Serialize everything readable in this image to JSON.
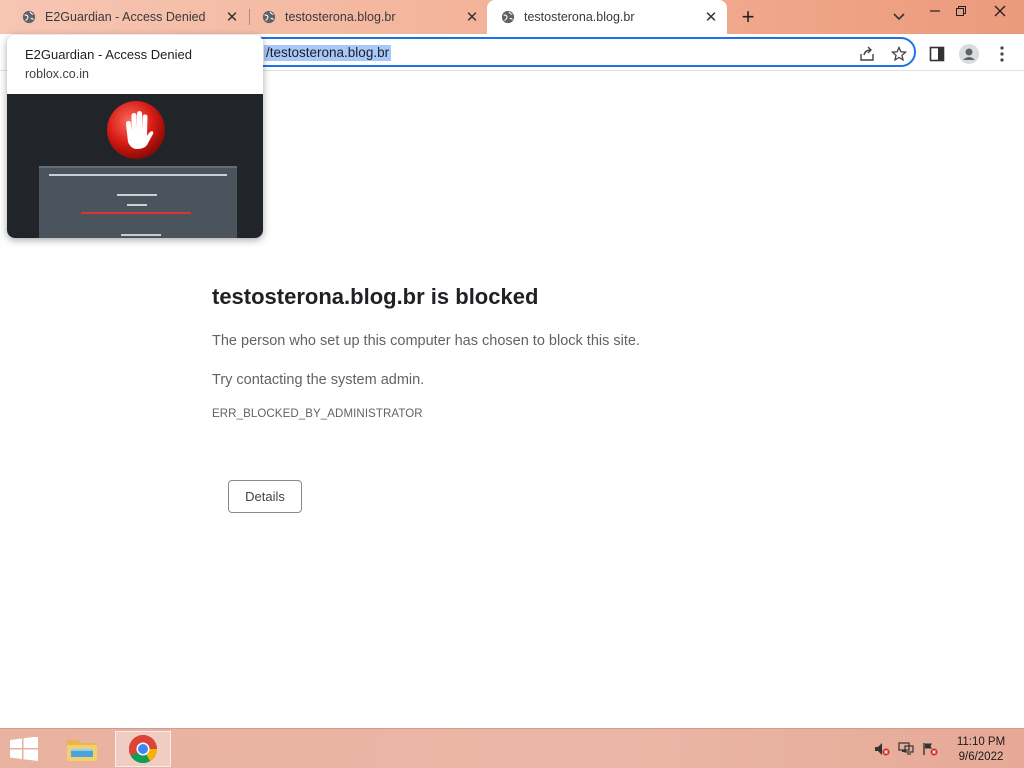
{
  "tabs": [
    {
      "title": "E2Guardian - Access Denied",
      "active": false
    },
    {
      "title": "testosterona.blog.br",
      "active": false
    },
    {
      "title": "testosterona.blog.br",
      "active": true
    }
  ],
  "icons": {
    "tab_favicon": "globe-icon",
    "tab_close": "close-icon",
    "new_tab": "plus-icon",
    "tab_search": "chevron-down-icon",
    "minimize": "minimize-icon",
    "restore": "restore-icon",
    "close_window": "close-icon",
    "share": "share-icon",
    "bookmark": "star-icon",
    "side_panel": "side-panel-icon",
    "profile": "profile-icon",
    "menu": "kebab-menu-icon"
  },
  "address_bar": {
    "url": "/testosterona.blog.br"
  },
  "hover_card": {
    "title": "E2Guardian - Access Denied",
    "domain": "roblox.co.in"
  },
  "page": {
    "headline": "testosterona.blog.br is blocked",
    "line1": "The person who set up this computer has chosen to block this site.",
    "line2": "Try contacting the system admin.",
    "error_code": "ERR_BLOCKED_BY_ADMINISTRATOR",
    "details_label": "Details"
  },
  "taskbar": {
    "time": "11:10 PM",
    "date": "9/6/2022"
  },
  "colors": {
    "accent": "#1a73e8",
    "selection": "#a8c7fa",
    "tabstrip": "#f3b49b",
    "taskbar": "#e9b1a0"
  }
}
